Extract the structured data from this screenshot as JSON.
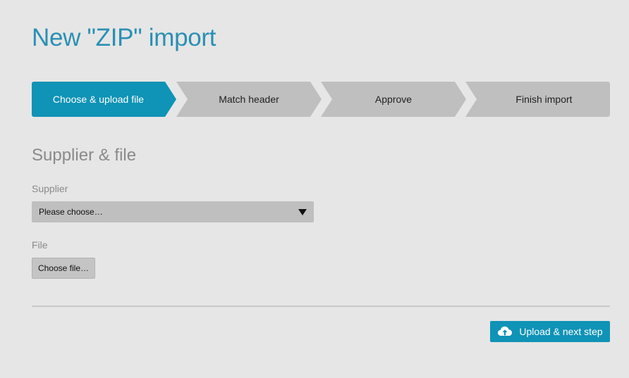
{
  "page": {
    "title": "New \"ZIP\" import"
  },
  "stepper": {
    "steps": [
      {
        "label": "Choose & upload file",
        "state": "active"
      },
      {
        "label": "Match header",
        "state": "inactive"
      },
      {
        "label": "Approve",
        "state": "inactive"
      },
      {
        "label": "Finish import",
        "state": "inactive"
      }
    ]
  },
  "form": {
    "section_title": "Supplier & file",
    "supplier": {
      "label": "Supplier",
      "selected_value": "Please choose…",
      "icon": "caret-down-icon"
    },
    "file": {
      "label": "File",
      "button_label": "Choose file…"
    }
  },
  "actions": {
    "upload_label": "Upload & next step",
    "upload_icon": "cloud-upload-icon"
  },
  "colors": {
    "accent": "#0f93b6",
    "title": "#2a90b4",
    "inactive_step": "#bfbfbf",
    "background": "#e6e6e6",
    "muted_text": "#8a8a8a"
  }
}
